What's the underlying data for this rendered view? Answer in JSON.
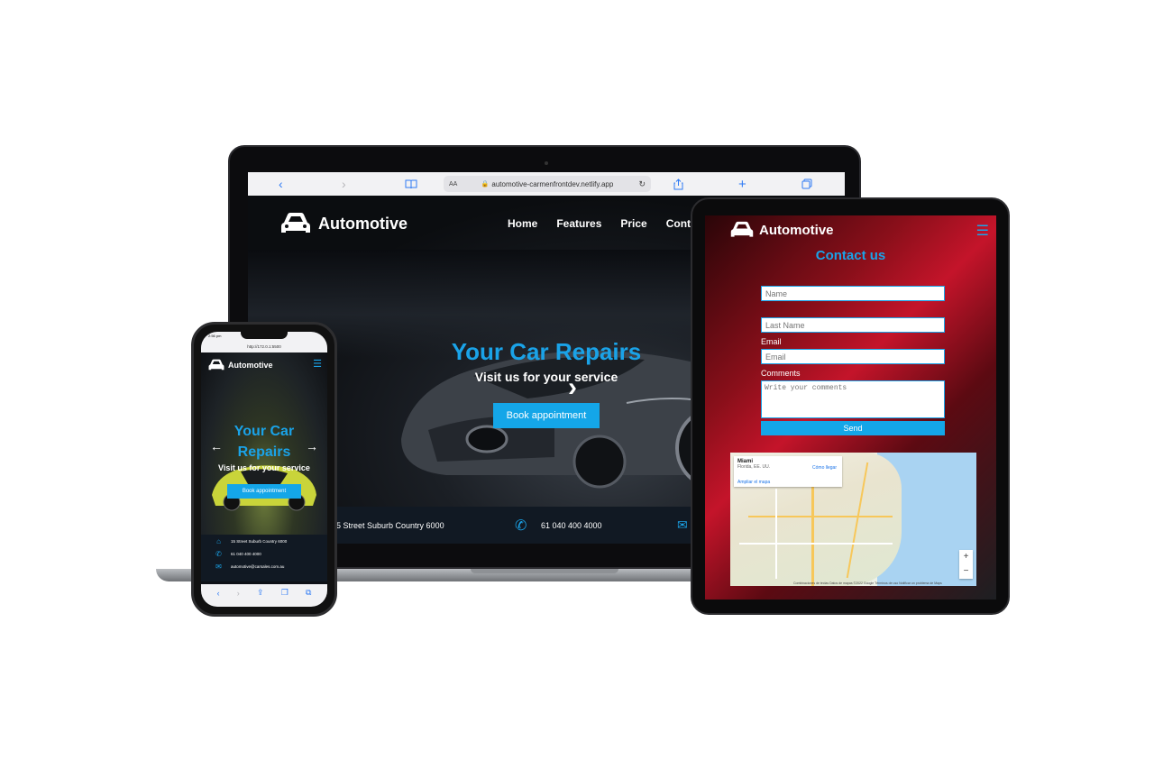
{
  "laptop": {
    "safari": {
      "url": "automotive-carmenfrontdev.netlify.app",
      "aa_label": "AA",
      "reload_icon": "reload-icon",
      "back_icon": "chevron-left-icon",
      "forward_icon": "chevron-right-icon",
      "bookmarks_icon": "book-icon",
      "share_icon": "share-icon",
      "new_tab_icon": "plus-icon",
      "tabs_icon": "tabs-icon"
    },
    "site": {
      "brand": "Automotive",
      "nav": [
        "Home",
        "Features",
        "Price",
        "Conta"
      ],
      "hero_title": "Your Car Repairs",
      "hero_subtitle": "Visit us for your service",
      "hero_button": "Book appointment",
      "footer_address": "5 Street Suburb Country 6000",
      "footer_phone": "61 040 400 4000"
    }
  },
  "tablet": {
    "brand": "Automotive",
    "title": "Contact us",
    "form": {
      "name_placeholder": "Name",
      "last_name_placeholder": "Last Name",
      "email_label": "Email",
      "email_placeholder": "Email",
      "comments_label": "Comments",
      "comments_placeholder": "Write your comments",
      "send_label": "Send"
    },
    "map": {
      "city": "Miami",
      "region": "Florida, EE. UU.",
      "directions": "Cómo llegar",
      "enlarge": "Ampliar el mapa",
      "zoom_in": "+",
      "zoom_out": "−",
      "footer": "Combinaciones de teclas  Datos de mapas ©2022 Google  Términos de uso  Notificar un problema de Maps"
    }
  },
  "phone": {
    "status_time": "2:56 pm",
    "url": "http://172.0.1:5500",
    "brand": "Automotive",
    "hero_title": "Your Car Repairs",
    "hero_subtitle": "Visit us for your service",
    "hero_button": "Book appointment",
    "info": {
      "address": "15 Street Suburb Country 6000",
      "phone": "61 040 400 4000",
      "email": "automotive@carsales.com.au"
    }
  },
  "colors": {
    "accent": "#1aa3e8",
    "button": "#14a6e8",
    "footer_bg": "#111923",
    "device_frame": "#0b0b0c"
  }
}
